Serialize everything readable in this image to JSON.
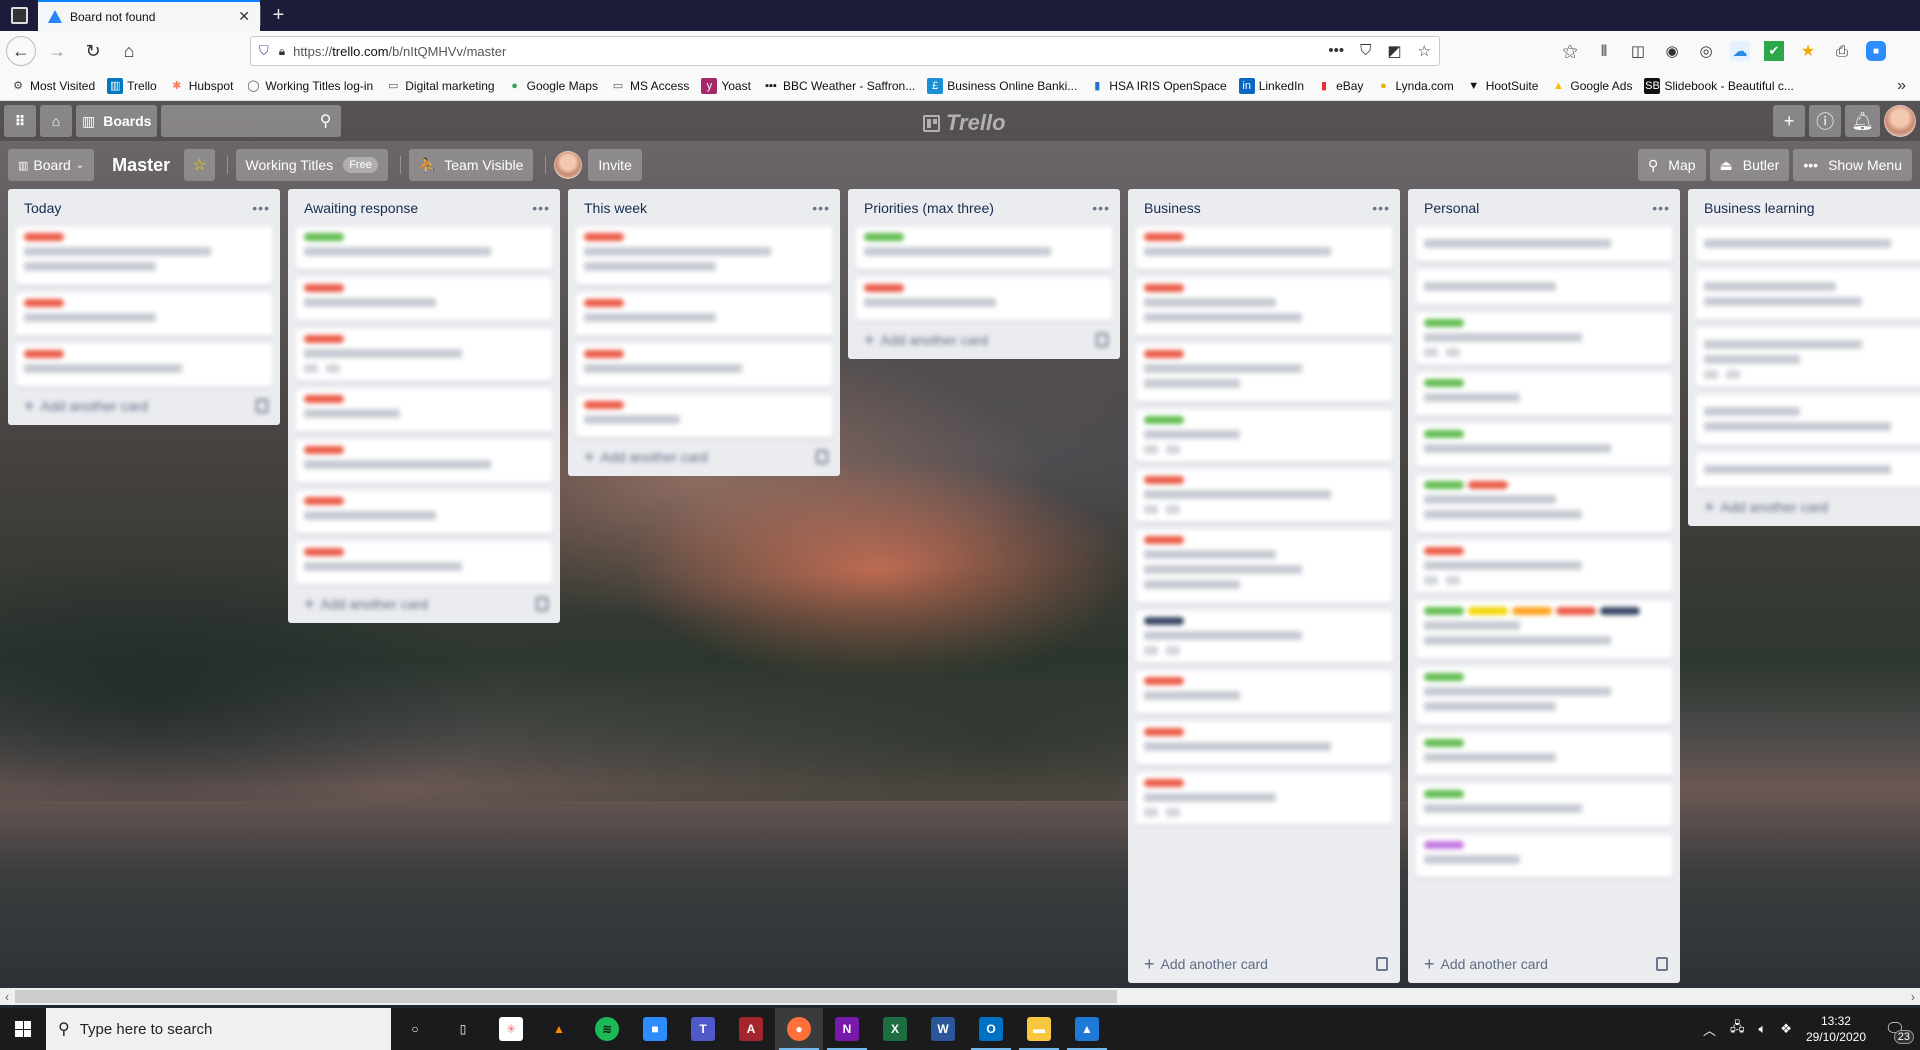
{
  "browser": {
    "tab_title": "Board not found",
    "url_prefix": "https://",
    "url_domain": "trello.com",
    "url_path": "/b/nItQMHVv/master",
    "bookmarks": [
      {
        "label": "Most Visited",
        "icon": "gear-icon",
        "glyph": "⚙",
        "color": "#444444",
        "bg": "transparent"
      },
      {
        "label": "Trello",
        "icon": "trello-icon",
        "glyph": "▥",
        "color": "#ffffff",
        "bg": "#0079bf"
      },
      {
        "label": "Hubspot",
        "icon": "hubspot-icon",
        "glyph": "✱",
        "color": "#ff7a59",
        "bg": "transparent"
      },
      {
        "label": "Working Titles log-in",
        "icon": "chat-bubble-icon",
        "glyph": "◯",
        "color": "#555555",
        "bg": "transparent"
      },
      {
        "label": "Digital marketing",
        "icon": "folder-icon",
        "glyph": "▭",
        "color": "#555555",
        "bg": "transparent"
      },
      {
        "label": "Google Maps",
        "icon": "map-pin-icon",
        "glyph": "●",
        "color": "#34a853",
        "bg": "transparent"
      },
      {
        "label": "MS Access",
        "icon": "folder-icon",
        "glyph": "▭",
        "color": "#555555",
        "bg": "transparent"
      },
      {
        "label": "Yoast",
        "icon": "yoast-icon",
        "glyph": "y",
        "color": "#ffffff",
        "bg": "#a4286a"
      },
      {
        "label": "BBC Weather - Saffron...",
        "icon": "bbc-icon",
        "glyph": "▪▪▪",
        "color": "#111111",
        "bg": "transparent"
      },
      {
        "label": "Business Online Banki...",
        "icon": "bank-icon",
        "glyph": "£",
        "color": "#ffffff",
        "bg": "#1a8fd6"
      },
      {
        "label": "HSA IRIS OpenSpace",
        "icon": "bar-chart-icon",
        "glyph": "▮",
        "color": "#1f6fd6",
        "bg": "transparent"
      },
      {
        "label": "LinkedIn",
        "icon": "linkedin-icon",
        "glyph": "in",
        "color": "#ffffff",
        "bg": "#0a66c2"
      },
      {
        "label": "eBay",
        "icon": "shopping-bag-icon",
        "glyph": "▮",
        "color": "#e53238",
        "bg": "transparent"
      },
      {
        "label": "Lynda.com",
        "icon": "lynda-icon",
        "glyph": "●",
        "color": "#e8b100",
        "bg": "transparent"
      },
      {
        "label": "HootSuite",
        "icon": "owl-icon",
        "glyph": "▼",
        "color": "#111111",
        "bg": "transparent"
      },
      {
        "label": "Google Ads",
        "icon": "google-ads-icon",
        "glyph": "▲",
        "color": "#fbbc04",
        "bg": "transparent"
      },
      {
        "label": "Slidebook - Beautiful c...",
        "icon": "slidebook-icon",
        "glyph": "SB",
        "color": "#ffffff",
        "bg": "#111111"
      }
    ]
  },
  "trello": {
    "boards_label": "Boards",
    "search_placeholder": "",
    "logo_text": "Trello",
    "board_view_label": "Board",
    "board_name": "Master",
    "team_name": "Working Titles",
    "team_plan": "Free",
    "visibility_label": "Team Visible",
    "invite_label": "Invite",
    "map_label": "Map",
    "butler_label": "Butler",
    "show_menu_label": "Show Menu",
    "add_card_label": "Add another card",
    "colors": {
      "green": "#61bd4f",
      "red": "#eb5a46",
      "yellow": "#f2d600",
      "orange": "#ff9f1a",
      "black": "#344563",
      "purple": "#c377e0"
    },
    "lists": [
      {
        "title": "Today",
        "cards": [
          {
            "labels": [
              "red"
            ],
            "lines": 2
          },
          {
            "labels": [
              "red"
            ],
            "lines": 1
          },
          {
            "labels": [
              "red"
            ],
            "lines": 1
          }
        ]
      },
      {
        "title": "Awaiting response",
        "cards": [
          {
            "labels": [
              "green"
            ],
            "lines": 1
          },
          {
            "labels": [
              "red"
            ],
            "lines": 1
          },
          {
            "labels": [
              "red"
            ],
            "lines": 1,
            "badges": true
          },
          {
            "labels": [
              "red"
            ],
            "lines": 1
          },
          {
            "labels": [
              "red"
            ],
            "lines": 1
          },
          {
            "labels": [
              "red"
            ],
            "lines": 1
          },
          {
            "labels": [
              "red"
            ],
            "lines": 1
          }
        ]
      },
      {
        "title": "This week",
        "cards": [
          {
            "labels": [
              "red"
            ],
            "lines": 2
          },
          {
            "labels": [
              "red"
            ],
            "lines": 1
          },
          {
            "labels": [
              "red"
            ],
            "lines": 1
          },
          {
            "labels": [
              "red"
            ],
            "lines": 1
          }
        ]
      },
      {
        "title": "Priorities (max three)",
        "cards": [
          {
            "labels": [
              "green"
            ],
            "lines": 1
          },
          {
            "labels": [
              "red"
            ],
            "lines": 1
          }
        ]
      },
      {
        "title": "Business",
        "footer_visible": true,
        "cards": [
          {
            "labels": [
              "red"
            ],
            "lines": 1
          },
          {
            "labels": [
              "red"
            ],
            "lines": 2
          },
          {
            "labels": [
              "red"
            ],
            "lines": 2
          },
          {
            "labels": [
              "green"
            ],
            "lines": 1,
            "badges": true
          },
          {
            "labels": [
              "red"
            ],
            "lines": 1,
            "badges": true
          },
          {
            "labels": [
              "red"
            ],
            "lines": 3
          },
          {
            "labels": [
              "black"
            ],
            "lines": 1,
            "badges": true
          },
          {
            "labels": [
              "red"
            ],
            "lines": 1
          },
          {
            "labels": [
              "red"
            ],
            "lines": 1
          },
          {
            "labels": [
              "red"
            ],
            "lines": 1,
            "badges": true
          }
        ]
      },
      {
        "title": "Personal",
        "footer_visible": true,
        "cards": [
          {
            "labels": [],
            "lines": 1
          },
          {
            "labels": [],
            "lines": 1
          },
          {
            "labels": [
              "green"
            ],
            "lines": 1,
            "badges": true
          },
          {
            "labels": [
              "green"
            ],
            "lines": 1
          },
          {
            "labels": [
              "green"
            ],
            "lines": 1
          },
          {
            "labels": [
              "green",
              "red"
            ],
            "lines": 2
          },
          {
            "labels": [
              "red"
            ],
            "lines": 1,
            "badges": true
          },
          {
            "labels": [
              "green",
              "yellow",
              "orange",
              "red",
              "black"
            ],
            "lines": 2
          },
          {
            "labels": [
              "green"
            ],
            "lines": 2
          },
          {
            "labels": [
              "green"
            ],
            "lines": 1
          },
          {
            "labels": [
              "green"
            ],
            "lines": 1
          },
          {
            "labels": [
              "purple"
            ],
            "lines": 1
          }
        ]
      },
      {
        "title": "Business learning",
        "cards": [
          {
            "labels": [],
            "lines": 1
          },
          {
            "labels": [],
            "lines": 2
          },
          {
            "labels": [],
            "lines": 2,
            "badges": true
          },
          {
            "labels": [],
            "lines": 2
          },
          {
            "labels": [],
            "lines": 1
          }
        ]
      }
    ]
  },
  "taskbar": {
    "search_placeholder": "Type here to search",
    "apps": [
      {
        "name": "cortana",
        "glyph": "○",
        "bg": "transparent",
        "active": false,
        "running": false
      },
      {
        "name": "task-view",
        "glyph": "▯",
        "bg": "transparent",
        "active": false,
        "running": false
      },
      {
        "name": "asana",
        "glyph": "✳",
        "bg": "#ffffff",
        "fg": "#f06a6a",
        "active": false,
        "running": false
      },
      {
        "name": "vlc",
        "glyph": "▲",
        "bg": "transparent",
        "fg": "#ff8800",
        "active": false,
        "running": false
      },
      {
        "name": "spotify",
        "glyph": "≋",
        "bg": "#1db954",
        "fg": "#111",
        "round": true,
        "active": false,
        "running": false
      },
      {
        "name": "zoom",
        "glyph": "■",
        "bg": "#2d8cff",
        "active": false,
        "running": false
      },
      {
        "name": "teams",
        "glyph": "T",
        "bg": "#5059c9",
        "active": false,
        "running": false
      },
      {
        "name": "access",
        "glyph": "A",
        "bg": "#a4262c",
        "active": false,
        "running": false
      },
      {
        "name": "firefox",
        "glyph": "●",
        "bg": "#ff7139",
        "round": true,
        "active": true,
        "running": true
      },
      {
        "name": "onenote",
        "glyph": "N",
        "bg": "#7719aa",
        "active": false,
        "running": true
      },
      {
        "name": "excel",
        "glyph": "X",
        "bg": "#1d6f42",
        "active": false,
        "running": false
      },
      {
        "name": "word",
        "glyph": "W",
        "bg": "#2b579a",
        "active": false,
        "running": false
      },
      {
        "name": "outlook",
        "glyph": "O",
        "bg": "#0072c6",
        "active": false,
        "running": true
      },
      {
        "name": "file-explorer",
        "glyph": "▬",
        "bg": "#f8c73e",
        "active": false,
        "running": true
      },
      {
        "name": "photos",
        "glyph": "▲",
        "bg": "#1e7ad6",
        "active": false,
        "running": true
      }
    ],
    "time": "13:32",
    "date": "29/10/2020",
    "notification_count": "23"
  }
}
